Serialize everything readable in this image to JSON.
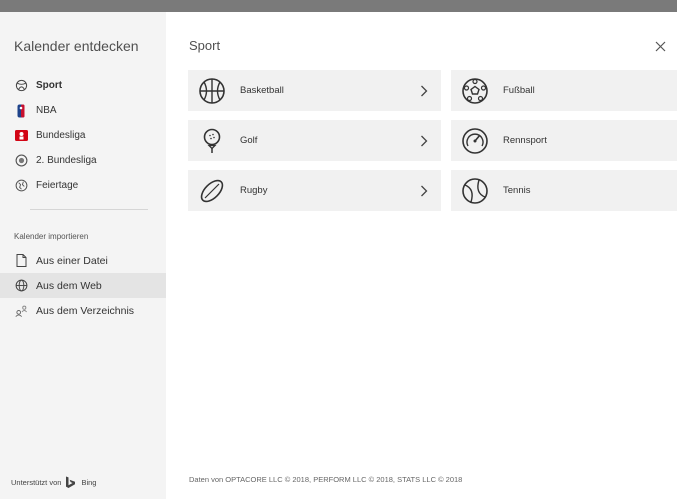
{
  "sidebar": {
    "title": "Kalender entdecken",
    "items": [
      {
        "label": "Sport",
        "icon": "sport-icon"
      },
      {
        "label": "NBA",
        "icon": "nba-icon"
      },
      {
        "label": "Bundesliga",
        "icon": "bundesliga-icon"
      },
      {
        "label": "2. Bundesliga",
        "icon": "bundesliga-2-icon"
      },
      {
        "label": "Feiertage",
        "icon": "globe-icon"
      }
    ],
    "import_section": "Kalender importieren",
    "import_items": [
      {
        "label": "Aus einer Datei",
        "icon": "file-icon"
      },
      {
        "label": "Aus dem Web",
        "icon": "web-icon"
      },
      {
        "label": "Aus dem Verzeichnis",
        "icon": "directory-icon"
      }
    ],
    "footer_prefix": "Unterstützt von",
    "footer_brand": "Bing"
  },
  "main": {
    "title": "Sport",
    "tiles": [
      {
        "label": "Basketball",
        "icon": "basketball-icon"
      },
      {
        "label": "Fußball",
        "icon": "soccer-icon"
      },
      {
        "label": "Golf",
        "icon": "golf-icon"
      },
      {
        "label": "Rennsport",
        "icon": "speedometer-icon"
      },
      {
        "label": "Rugby",
        "icon": "rugby-icon"
      },
      {
        "label": "Tennis",
        "icon": "tennis-icon"
      }
    ],
    "footer": "Daten von OPTACORE LLC © 2018, PERFORM LLC © 2018, STATS LLC © 2018"
  },
  "colors": {
    "nba_blue": "#1d428a",
    "nba_red": "#c8102e",
    "bundesliga_red": "#d20515",
    "selected_bg": "#e4e4e4",
    "tile_bg": "#f1f1f1"
  }
}
